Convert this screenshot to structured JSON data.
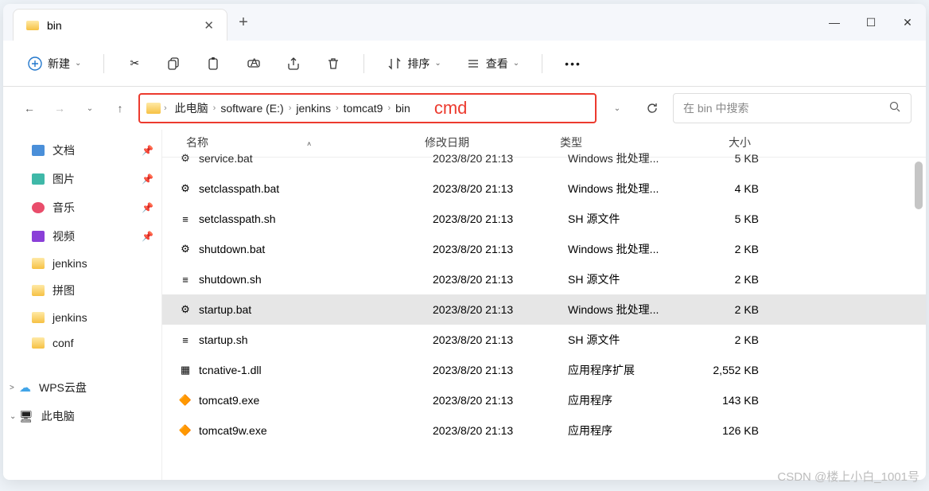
{
  "tab": {
    "title": "bin"
  },
  "toolbar": {
    "new": "新建",
    "sort": "排序",
    "view": "查看"
  },
  "breadcrumb": [
    "此电脑",
    "software (E:)",
    "jenkins",
    "tomcat9",
    "bin"
  ],
  "annotation": "cmd",
  "search_placeholder": "在 bin 中搜索",
  "sidebar": [
    {
      "label": "文档",
      "icon": "fdoc",
      "pin": true
    },
    {
      "label": "图片",
      "icon": "fpic",
      "pin": true
    },
    {
      "label": "音乐",
      "icon": "fmus",
      "pin": true
    },
    {
      "label": "视频",
      "icon": "fvid",
      "pin": true
    },
    {
      "label": "jenkins",
      "icon": "fyellow",
      "pin": false
    },
    {
      "label": "拼图",
      "icon": "fyellow",
      "pin": false
    },
    {
      "label": "jenkins",
      "icon": "fyellow",
      "pin": false
    },
    {
      "label": "conf",
      "icon": "fyellow",
      "pin": false
    }
  ],
  "sidebar2": [
    {
      "label": "WPS云盘",
      "icon": "fcloud",
      "expand": ">"
    },
    {
      "label": "此电脑",
      "icon": "fpc",
      "expand": "⌄"
    }
  ],
  "columns": {
    "name": "名称",
    "date": "修改日期",
    "type": "类型",
    "size": "大小"
  },
  "files": [
    {
      "name": "service.bat",
      "date": "2023/8/20 21:13",
      "type": "Windows 批处理...",
      "size": "5 KB",
      "ico": "bat",
      "cut": true
    },
    {
      "name": "setclasspath.bat",
      "date": "2023/8/20 21:13",
      "type": "Windows 批处理...",
      "size": "4 KB",
      "ico": "bat"
    },
    {
      "name": "setclasspath.sh",
      "date": "2023/8/20 21:13",
      "type": "SH 源文件",
      "size": "5 KB",
      "ico": "sh"
    },
    {
      "name": "shutdown.bat",
      "date": "2023/8/20 21:13",
      "type": "Windows 批处理...",
      "size": "2 KB",
      "ico": "bat"
    },
    {
      "name": "shutdown.sh",
      "date": "2023/8/20 21:13",
      "type": "SH 源文件",
      "size": "2 KB",
      "ico": "sh"
    },
    {
      "name": "startup.bat",
      "date": "2023/8/20 21:13",
      "type": "Windows 批处理...",
      "size": "2 KB",
      "ico": "bat",
      "selected": true
    },
    {
      "name": "startup.sh",
      "date": "2023/8/20 21:13",
      "type": "SH 源文件",
      "size": "2 KB",
      "ico": "sh"
    },
    {
      "name": "tcnative-1.dll",
      "date": "2023/8/20 21:13",
      "type": "应用程序扩展",
      "size": "2,552 KB",
      "ico": "dll"
    },
    {
      "name": "tomcat9.exe",
      "date": "2023/8/20 21:13",
      "type": "应用程序",
      "size": "143 KB",
      "ico": "exe"
    },
    {
      "name": "tomcat9w.exe",
      "date": "2023/8/20 21:13",
      "type": "应用程序",
      "size": "126 KB",
      "ico": "exe"
    }
  ],
  "watermark": "CSDN @楼上小白_1001号"
}
